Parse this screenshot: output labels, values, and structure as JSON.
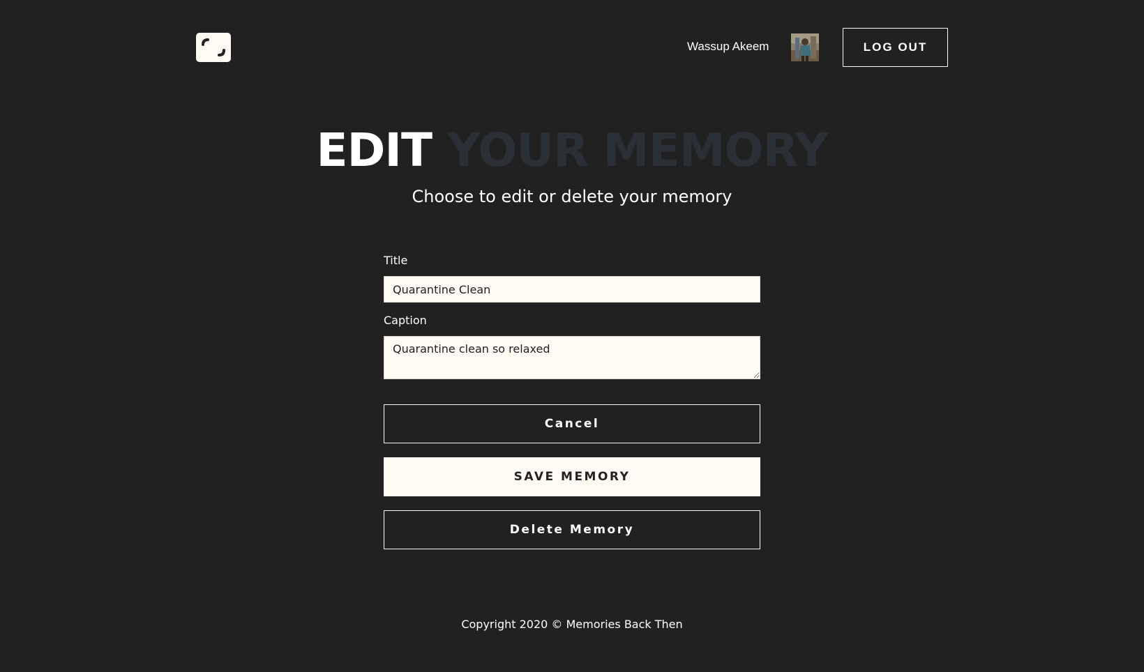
{
  "header": {
    "logo_icon": "camera-corner-logo-icon",
    "greeting": "Wassup Akeem",
    "avatar_icon": "user-avatar",
    "logout_label": "LOG OUT"
  },
  "heading": {
    "strong": "EDIT",
    "muted": "YOUR MEMORY",
    "subtitle": "Choose to edit or delete your memory"
  },
  "form": {
    "title_label": "Title",
    "title_value": "Quarantine Clean",
    "caption_label": "Caption",
    "caption_value": "Quarantine clean so relaxed",
    "cancel_label": "Cancel",
    "save_label": "SAVE MEMORY",
    "delete_label": "Delete Memory"
  },
  "footer": {
    "copyright": "Copyright 2020 © Memories Back Then"
  },
  "colors": {
    "background": "#212121",
    "cream": "#fffaf3",
    "muted_heading": "#2b2f36",
    "text": "#ffffff"
  }
}
